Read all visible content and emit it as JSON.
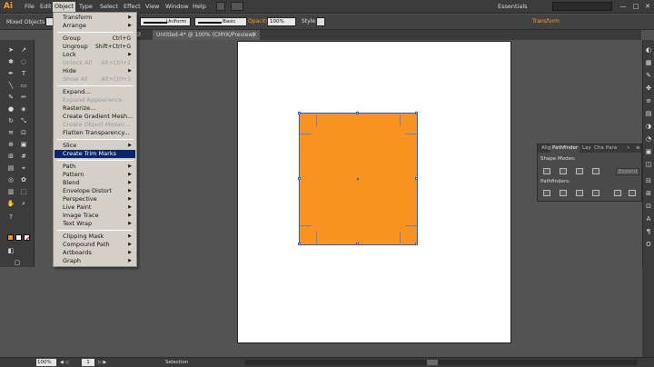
{
  "app": {
    "logo": "Ai"
  },
  "menubar": {
    "items": [
      "File",
      "Edit",
      "Object",
      "Type",
      "Select",
      "Effect",
      "View",
      "Window",
      "Help"
    ],
    "workspace": "Essentials",
    "win_min": "—",
    "win_max": "□",
    "win_close": "✕"
  },
  "control": {
    "selection_type": "Mixed Objects",
    "stroke_weight": "Uniform",
    "brush": "Basic",
    "opacity_label": "Opacity:",
    "opacity_value": "100%",
    "style_label": "Style:",
    "transform_label": "Transform"
  },
  "document": {
    "tab_title": "Untitled-4* @ 100% (CMYK/Preview)",
    "close": "×",
    "partial_tab": "Ø"
  },
  "object_menu": {
    "items": [
      {
        "label": "Transform",
        "submenu": true
      },
      {
        "label": "Arrange",
        "submenu": true
      },
      {
        "sep": true
      },
      {
        "label": "Group",
        "shortcut": "Ctrl+G"
      },
      {
        "label": "Ungroup",
        "shortcut": "Shift+Ctrl+G"
      },
      {
        "label": "Lock",
        "submenu": true
      },
      {
        "label": "Unlock All",
        "shortcut": "Alt+Ctrl+2",
        "disabled": true
      },
      {
        "label": "Hide",
        "submenu": true
      },
      {
        "label": "Show All",
        "shortcut": "Alt+Ctrl+3",
        "disabled": true
      },
      {
        "sep": true
      },
      {
        "label": "Expand..."
      },
      {
        "label": "Expand Appearance",
        "disabled": true
      },
      {
        "label": "Rasterize..."
      },
      {
        "label": "Create Gradient Mesh..."
      },
      {
        "label": "Create Object Mosaic...",
        "disabled": true
      },
      {
        "label": "Flatten Transparency..."
      },
      {
        "sep": true
      },
      {
        "label": "Slice",
        "submenu": true
      },
      {
        "label": "Create Trim Marks",
        "highlighted": true
      },
      {
        "sep": true
      },
      {
        "label": "Path",
        "submenu": true
      },
      {
        "label": "Pattern",
        "submenu": true
      },
      {
        "label": "Blend",
        "submenu": true
      },
      {
        "label": "Envelope Distort",
        "submenu": true
      },
      {
        "label": "Perspective",
        "submenu": true
      },
      {
        "label": "Live Paint",
        "submenu": true
      },
      {
        "label": "Image Trace",
        "submenu": true
      },
      {
        "label": "Text Wrap",
        "submenu": true
      },
      {
        "sep": true
      },
      {
        "label": "Clipping Mask",
        "submenu": true
      },
      {
        "label": "Compound Path",
        "submenu": true
      },
      {
        "label": "Artboards",
        "submenu": true
      },
      {
        "label": "Graph",
        "submenu": true
      }
    ]
  },
  "pathfinder": {
    "tabs": [
      "Alig",
      "Pathfinder",
      "Lay",
      "Cha",
      "Para"
    ],
    "shape_modes_label": "Shape Modes:",
    "expand_label": "Expand",
    "pathfinders_label": "Pathfinders:"
  },
  "status": {
    "zoom": "100%",
    "page": "1",
    "tool": "Selection"
  },
  "colors": {
    "fill": "#f7931e",
    "accent": "#f7a021",
    "selection": "#2d5bd6",
    "menu_highlight": "#0a246a"
  }
}
